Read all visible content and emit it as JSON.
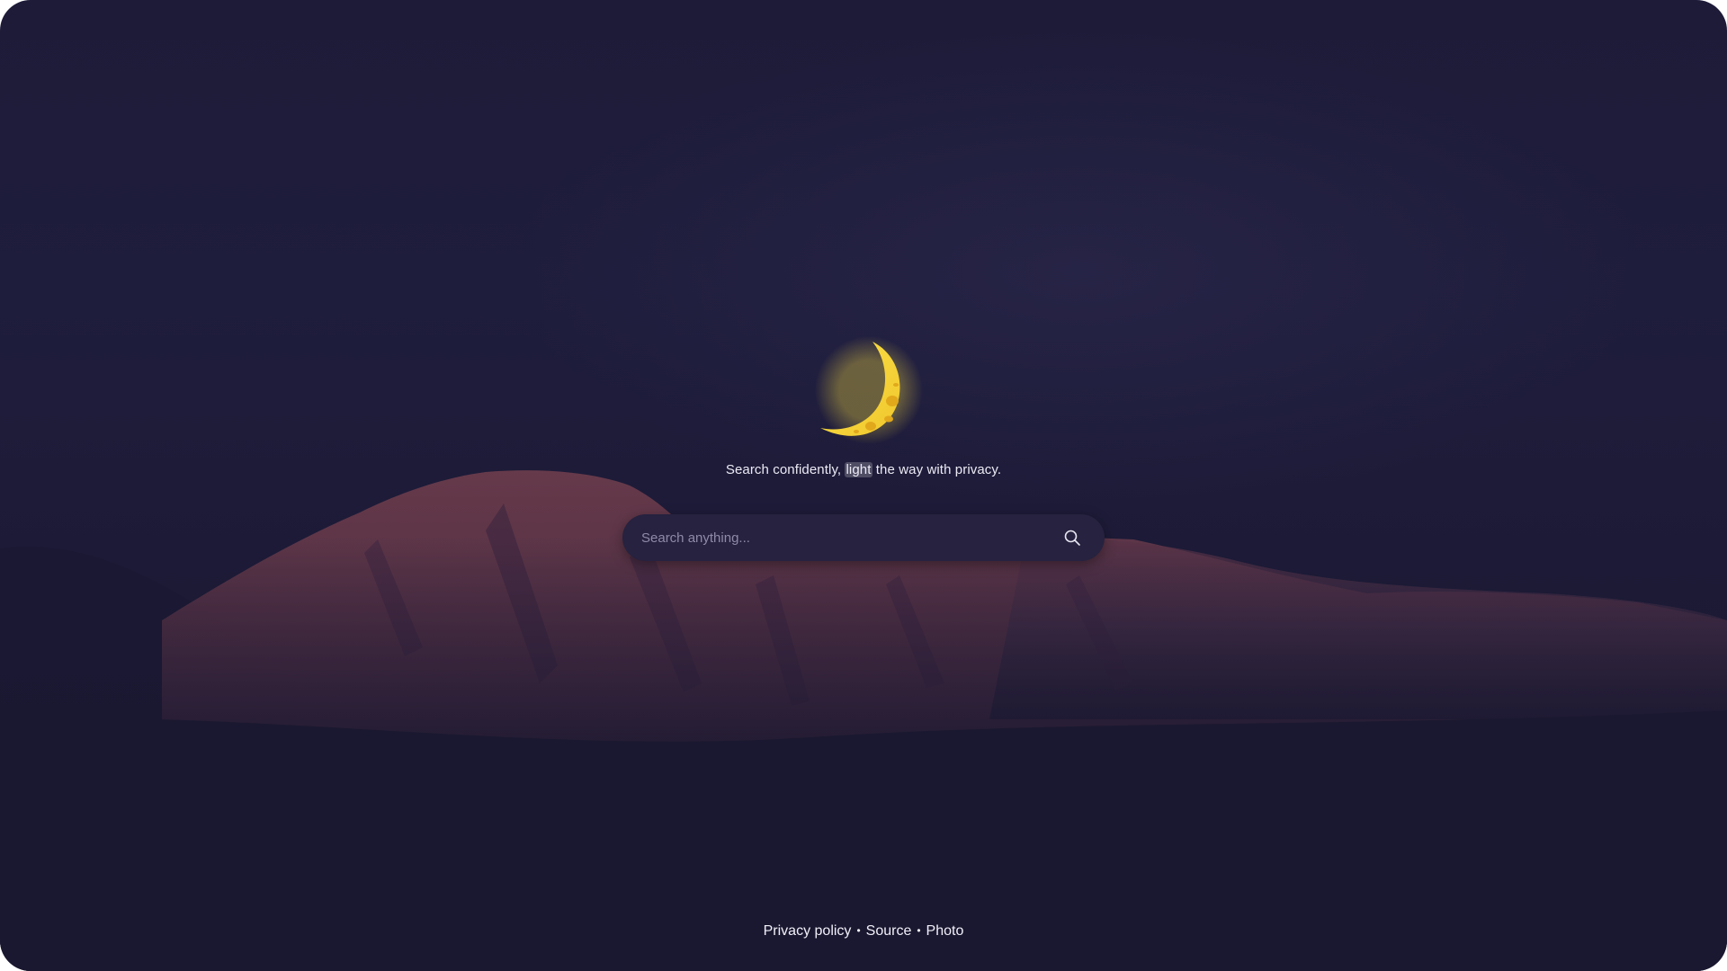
{
  "hero": {
    "tagline_before": "Search confidently, ",
    "tagline_highlight": "light",
    "tagline_after": " the way with privacy.",
    "logo_icon": "crescent-moon-icon"
  },
  "search": {
    "placeholder": "Search anything...",
    "value": "",
    "button_icon": "search-icon"
  },
  "footer": {
    "links": [
      "Privacy policy",
      "Source",
      "Photo"
    ],
    "separator": "•"
  },
  "colors": {
    "background": "#1d1b38",
    "moon": "#f2d33a",
    "search_bg": "#26223f",
    "mountain": "#6b3a48"
  }
}
